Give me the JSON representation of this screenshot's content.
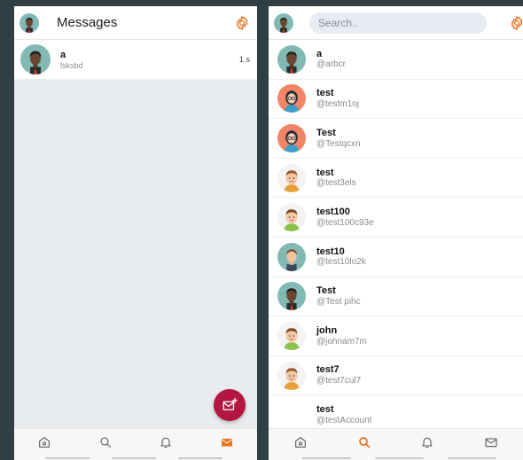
{
  "left_screen": {
    "title": "Messages",
    "conversations": [
      {
        "name": "a",
        "last_message": "lsksbd",
        "time": "1 s"
      }
    ],
    "fab_icon": "compose-message-icon"
  },
  "right_screen": {
    "search_placeholder": "Search..",
    "users": [
      {
        "name": "a",
        "handle": "@arbcr",
        "avatar": "dark-man"
      },
      {
        "name": "test",
        "handle": "@testm1oj",
        "avatar": "woman-glasses"
      },
      {
        "name": "Test",
        "handle": "@Testqcxn",
        "avatar": "woman-glasses"
      },
      {
        "name": "test",
        "handle": "@test3els",
        "avatar": "cartoon-man"
      },
      {
        "name": "test100",
        "handle": "@test100c93e",
        "avatar": "cartoon-man-green"
      },
      {
        "name": "test10",
        "handle": "@test10lo2k",
        "avatar": "light-man"
      },
      {
        "name": "Test",
        "handle": "@Test pihc",
        "avatar": "dark-man"
      },
      {
        "name": "john",
        "handle": "@johnam7m",
        "avatar": "cartoon-man-green"
      },
      {
        "name": "test7",
        "handle": "@test7cul7",
        "avatar": "cartoon-man"
      },
      {
        "name": "test",
        "handle": "@testAccount",
        "avatar": "blank"
      }
    ]
  },
  "nav": {
    "tabs": [
      "home-icon",
      "search-icon",
      "bell-icon",
      "mail-icon"
    ],
    "left_active": "mail-icon",
    "right_active": "search-icon"
  },
  "colors": {
    "accent": "#e8731c",
    "fab": "#b3163e",
    "background": "#2f3f44",
    "avatar_teal": "#7fb3b0",
    "avatar_coral": "#f2846a"
  }
}
